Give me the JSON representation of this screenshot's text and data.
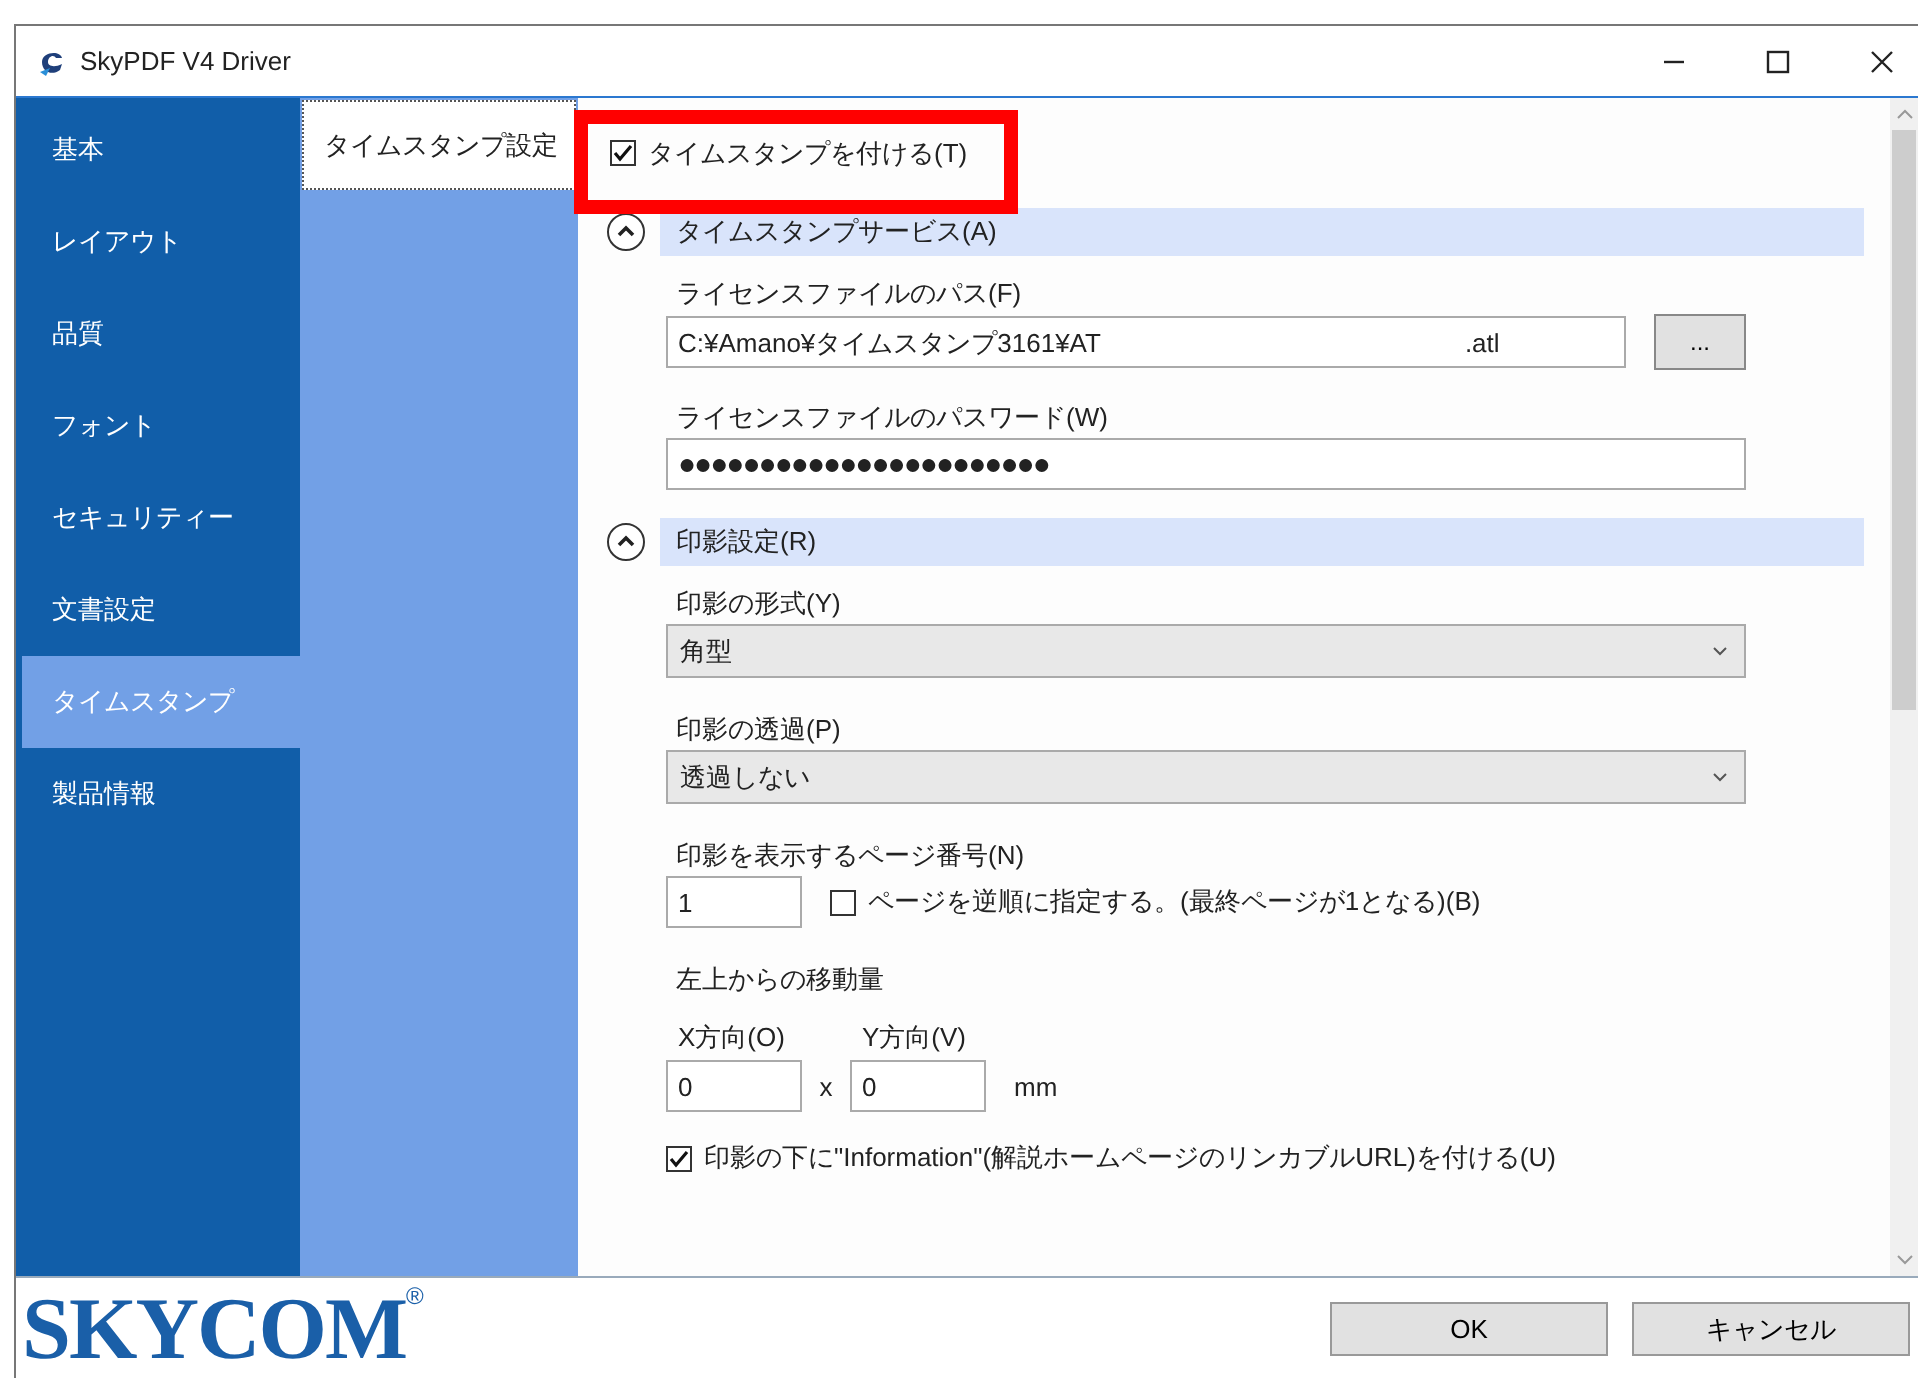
{
  "window": {
    "title": "SkyPDF V4 Driver"
  },
  "sidebar": {
    "items": [
      {
        "label": "基本",
        "selected": false
      },
      {
        "label": "レイアウト",
        "selected": false
      },
      {
        "label": "品質",
        "selected": false
      },
      {
        "label": "フォント",
        "selected": false
      },
      {
        "label": "セキュリティー",
        "selected": false
      },
      {
        "label": "文書設定",
        "selected": false
      },
      {
        "label": "タイムスタンプ",
        "selected": true
      },
      {
        "label": "製品情報",
        "selected": false
      }
    ]
  },
  "subnav": {
    "items": [
      {
        "label": "タイムスタンプ設定",
        "selected": true
      }
    ]
  },
  "enable_checkbox": {
    "label": "タイムスタンプを付ける(T)",
    "checked": true
  },
  "sections": [
    {
      "title": "タイムスタンプサービス(A)",
      "expanded": true,
      "fields": [
        {
          "kind": "file",
          "label": "ライセンスファイルのパス(F)",
          "value_start": "C:¥Amano¥タイムスタンプ3161¥AT",
          "value_end": ".atl",
          "button": "..."
        },
        {
          "kind": "password",
          "label": "ライセンスファイルのパスワード(W)",
          "value": "●●●●●●●●●●●●●●●●●●●●●●●"
        }
      ]
    },
    {
      "title": "印影設定(R)",
      "expanded": true,
      "fields": [
        {
          "kind": "select",
          "label": "印影の形式(Y)",
          "value": "角型"
        },
        {
          "kind": "select",
          "label": "印影の透過(P)",
          "value": "透過しない"
        },
        {
          "kind": "page",
          "label": "印影を表示するページ番号(N)",
          "value": "1",
          "checkbox": {
            "label": "ページを逆順に指定する。(最終ページが1となる)(B)",
            "checked": false
          }
        },
        {
          "kind": "offset",
          "label": "左上からの移動量",
          "x_label": "X方向(O)",
          "x_value": "0",
          "separator": "x",
          "y_label": "Y方向(V)",
          "y_value": "0",
          "unit": "mm"
        },
        {
          "kind": "checkbox",
          "label": "印影の下に\"Information\"(解説ホームページのリンカブルURL)を付ける(U)",
          "checked": true
        }
      ]
    }
  ],
  "logo": {
    "text": "SKYCOM",
    "mark": "®"
  },
  "buttons": [
    "OK",
    "キャンセル"
  ]
}
